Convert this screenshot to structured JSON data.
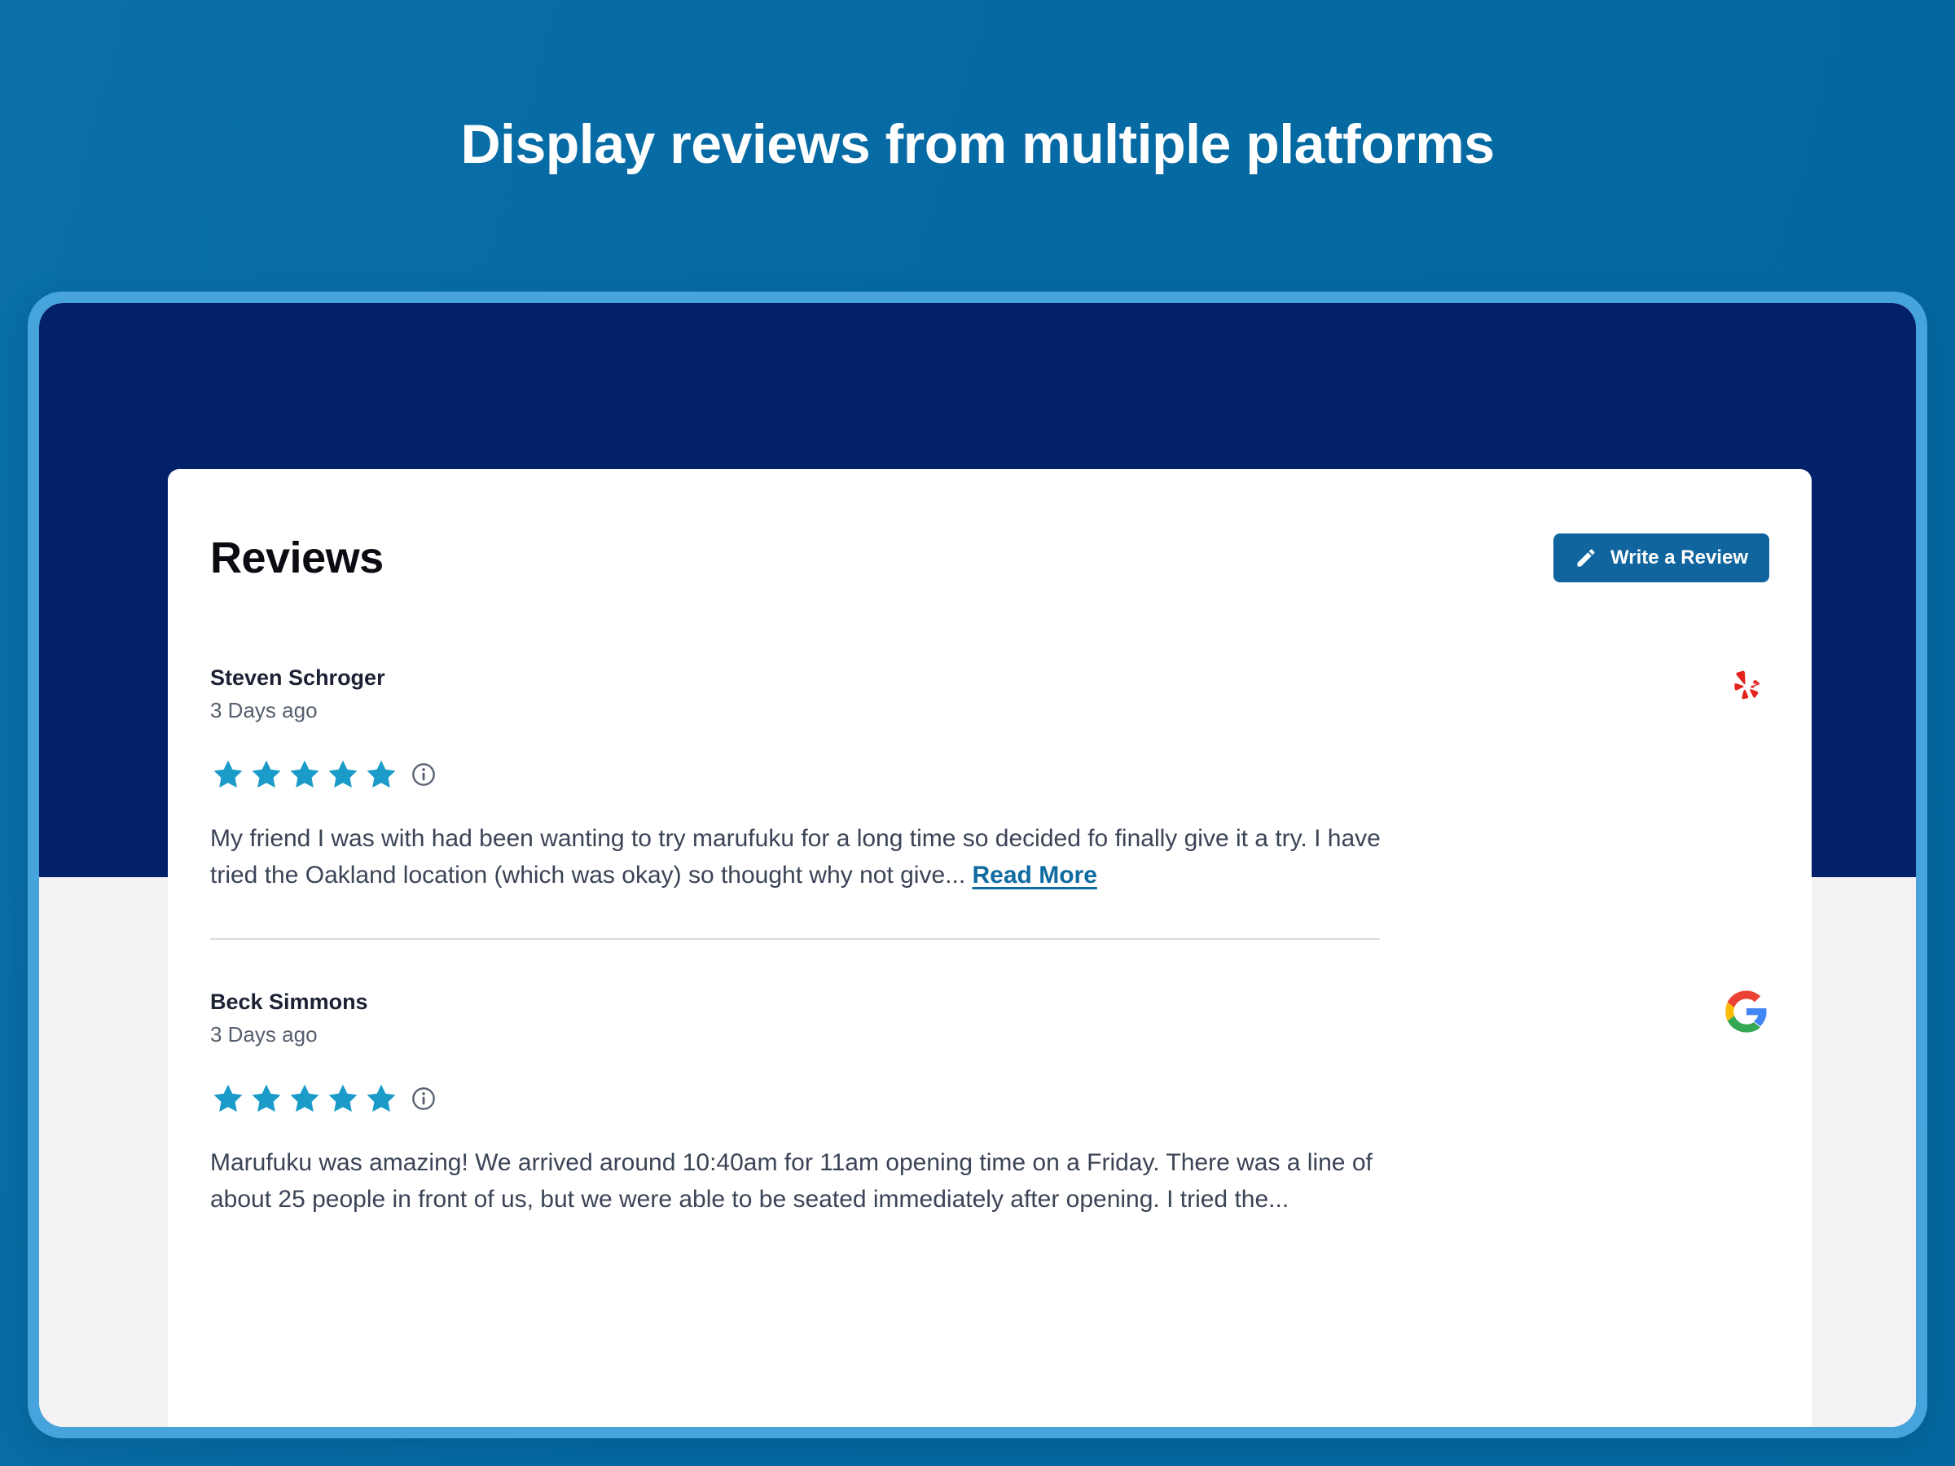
{
  "headline": "Display reviews from multiple platforms",
  "colors": {
    "page_background": "#0569a3",
    "frame_border": "#46a3dc",
    "hero_navy": "#032169",
    "body_gray": "#f5f2f5",
    "card_white": "#ffffff",
    "button_blue": "#10659e",
    "star_blue": "#1a9bc8",
    "link_blue": "#0e6ba0",
    "yelp_red": "#e3231e"
  },
  "card": {
    "title": "Reviews",
    "write_review_button": {
      "label": "Write a Review",
      "icon": "pencil-icon"
    }
  },
  "reviews": [
    {
      "name": "Steven Schroger",
      "date": "3 Days ago",
      "platform": "yelp",
      "rating": 5,
      "info_icon": "info-circle-icon",
      "text": "My friend I was with had been wanting to try marufuku for a long time so decided fo finally give it a try. I have tried the Oakland location (which was okay) so thought why not give...",
      "read_more_label": "Read More"
    },
    {
      "name": "Beck Simmons",
      "date": "3 Days ago",
      "platform": "google",
      "rating": 5,
      "info_icon": "info-circle-icon",
      "text": "Marufuku was amazing! We arrived around 10:40am for 11am opening time on a Friday. There was a line of about 25 people in front of us, but we were able to be seated immediately after opening. I tried the...",
      "read_more_label": ""
    }
  ]
}
